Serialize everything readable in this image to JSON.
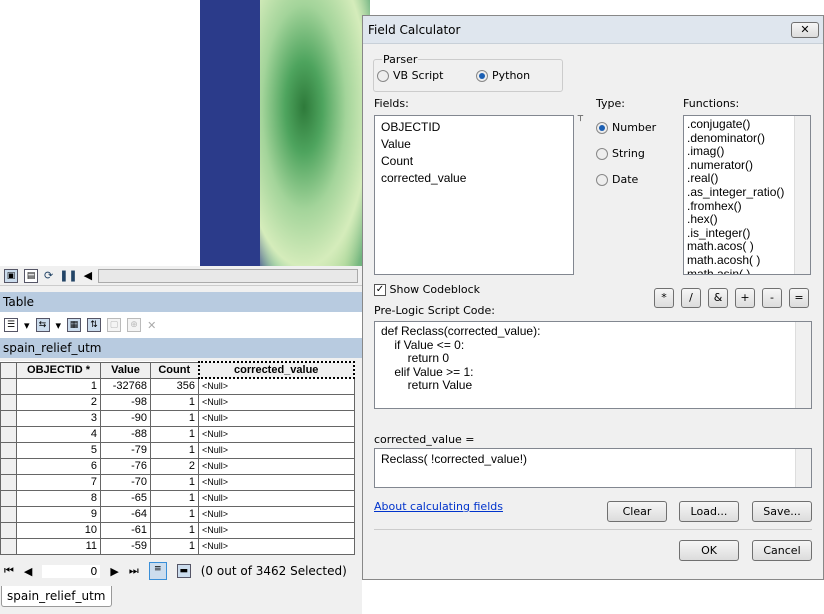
{
  "table": {
    "panel_title": "Table",
    "table_name": "spain_relief_utm",
    "columns": [
      "OBJECTID *",
      "Value",
      "Count",
      "corrected_value"
    ],
    "rows": [
      [
        "1",
        "-32768",
        "356",
        "<Null>"
      ],
      [
        "2",
        "-98",
        "1",
        "<Null>"
      ],
      [
        "3",
        "-90",
        "1",
        "<Null>"
      ],
      [
        "4",
        "-88",
        "1",
        "<Null>"
      ],
      [
        "5",
        "-79",
        "1",
        "<Null>"
      ],
      [
        "6",
        "-76",
        "2",
        "<Null>"
      ],
      [
        "7",
        "-70",
        "1",
        "<Null>"
      ],
      [
        "8",
        "-65",
        "1",
        "<Null>"
      ],
      [
        "9",
        "-64",
        "1",
        "<Null>"
      ],
      [
        "10",
        "-61",
        "1",
        "<Null>"
      ],
      [
        "11",
        "-59",
        "1",
        "<Null>"
      ]
    ],
    "record_position": "0",
    "selection_status": "(0 out of 3462 Selected)",
    "tab_label": "spain_relief_utm"
  },
  "dialog": {
    "title": "Field Calculator",
    "close_label": "✕",
    "parser_label": "Parser",
    "parser_options": [
      "VB Script",
      "Python"
    ],
    "parser_selected": "Python",
    "fields_label": "Fields:",
    "fields": [
      "OBJECTID",
      "Value",
      "Count",
      "corrected_value"
    ],
    "type_label": "Type:",
    "types": [
      "Number",
      "String",
      "Date"
    ],
    "type_selected": "Number",
    "functions_label": "Functions:",
    "functions": [
      ".conjugate()",
      ".denominator()",
      ".imag()",
      ".numerator()",
      ".real()",
      ".as_integer_ratio()",
      ".fromhex()",
      ".hex()",
      ".is_integer()",
      "math.acos( )",
      "math.acosh( )",
      "math.asin( )"
    ],
    "show_codeblock_label": "Show Codeblock",
    "show_codeblock_checked": true,
    "operators": [
      "*",
      "/",
      "&",
      "+",
      "-",
      "="
    ],
    "prelogic_label": "Pre-Logic Script Code:",
    "prelogic_code": [
      "def Reclass(corrected_value):",
      "    if Value <= 0:",
      "        return 0",
      "    elif Value >= 1:",
      "        return Value"
    ],
    "expression_label": "corrected_value =",
    "expression": "Reclass( !corrected_value!)",
    "help_link": "About calculating fields",
    "clear_label": "Clear",
    "load_label": "Load...",
    "save_label": "Save...",
    "ok_label": "OK",
    "cancel_label": "Cancel"
  }
}
